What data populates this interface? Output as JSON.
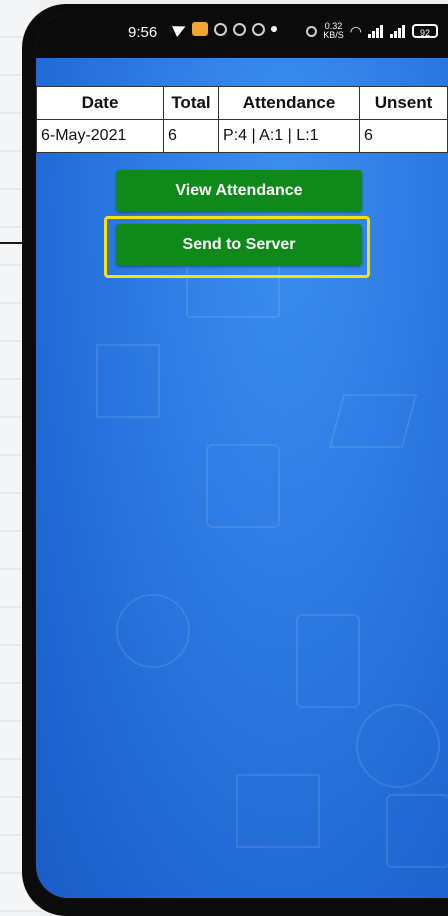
{
  "status_bar": {
    "time": "9:56",
    "net_speed_value": "0.32",
    "net_speed_unit": "KB/S",
    "battery": "92"
  },
  "table": {
    "headers": [
      "Date",
      "Total",
      "Attendance",
      "Unsent"
    ],
    "rows": [
      [
        "6-May-2021",
        "6",
        "P:4 | A:1 | L:1",
        "6"
      ]
    ]
  },
  "buttons": {
    "view_attendance": "View Attendance",
    "send_to_server": "Send to Server"
  },
  "colors": {
    "button_green": "#0f8a1a",
    "background_blue": "#2f7de6",
    "highlight_yellow": "#f4e20a"
  }
}
